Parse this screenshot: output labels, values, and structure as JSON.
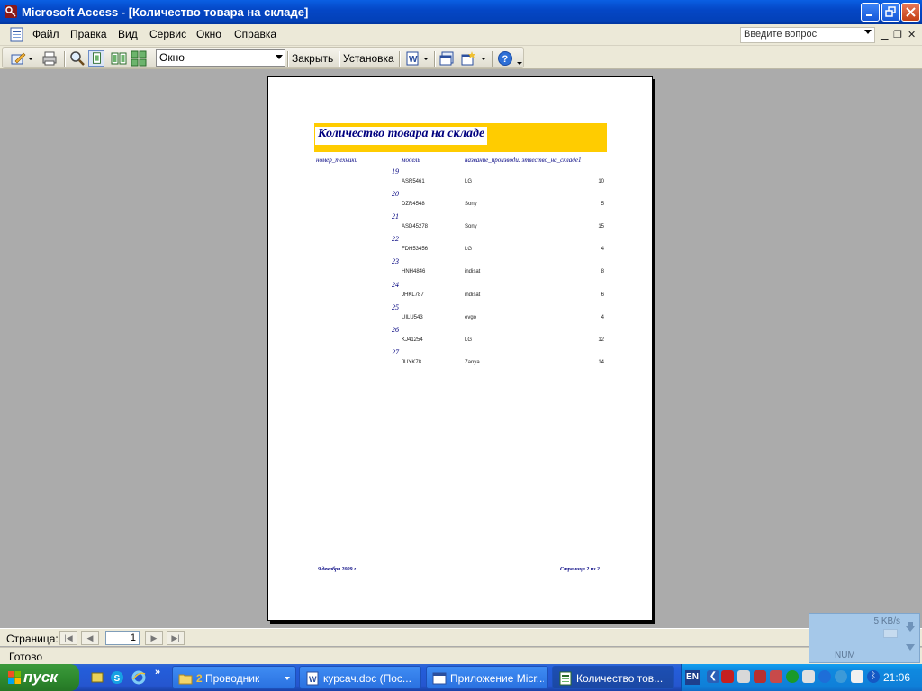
{
  "window": {
    "title": "Microsoft Access - [Количество товара на складе]"
  },
  "menu": {
    "items": [
      "Файл",
      "Правка",
      "Вид",
      "Сервис",
      "Окно",
      "Справка"
    ],
    "help_placeholder": "Введите вопрос"
  },
  "toolbar": {
    "zoom_value": "Окно",
    "close_label": "Закрыть",
    "setup_label": "Установка"
  },
  "report": {
    "title": "Количество товара на складе",
    "columns": [
      "номер_техники",
      "модель",
      "название_производителя",
      "Количество_на_складе"
    ],
    "col_header_display": {
      "num": "номер_техники",
      "model": "модель",
      "maker_qty": "название_производи. этвество_на_складе1"
    },
    "groups": [
      {
        "num": "19",
        "model": "ASR5461",
        "maker": "LG",
        "qty": "10"
      },
      {
        "num": "20",
        "model": "DZR4548",
        "maker": "Sony",
        "qty": "5"
      },
      {
        "num": "21",
        "model": "ASD45278",
        "maker": "Sony",
        "qty": "15"
      },
      {
        "num": "22",
        "model": "FDH53456",
        "maker": "LG",
        "qty": "4"
      },
      {
        "num": "23",
        "model": "HNH4846",
        "maker": "indisat",
        "qty": "8"
      },
      {
        "num": "24",
        "model": "JHKL787",
        "maker": "indisat",
        "qty": "6"
      },
      {
        "num": "25",
        "model": "UILU543",
        "maker": "evgo",
        "qty": "4"
      },
      {
        "num": "26",
        "model": "KJ41254",
        "maker": "LG",
        "qty": "12"
      },
      {
        "num": "27",
        "model": "JUYK78",
        "maker": "Zanya",
        "qty": "14"
      }
    ],
    "footer_date": "9 декабря 2009 г.",
    "footer_page": "Страница 2 из 2"
  },
  "navigation": {
    "label": "Страница:",
    "page": "1"
  },
  "status": {
    "text": "Готово"
  },
  "network": {
    "speed": "5 KB/s",
    "num_indicator": "NUM"
  },
  "taskbar": {
    "start_label": "пуск",
    "tasks": [
      {
        "label": "Проводник",
        "count": "2"
      },
      {
        "label": "курсач.doc (Пос..."
      },
      {
        "label": "Приложение Micr..."
      },
      {
        "label": "Количество тов..."
      }
    ],
    "lang": "EN",
    "clock": "21:06"
  },
  "colors": {
    "title_bar": "#0447c6",
    "report_band": "#ffcc00",
    "report_text": "#00007f",
    "taskbar": "#245edb",
    "start_button": "#2f8b2f"
  }
}
